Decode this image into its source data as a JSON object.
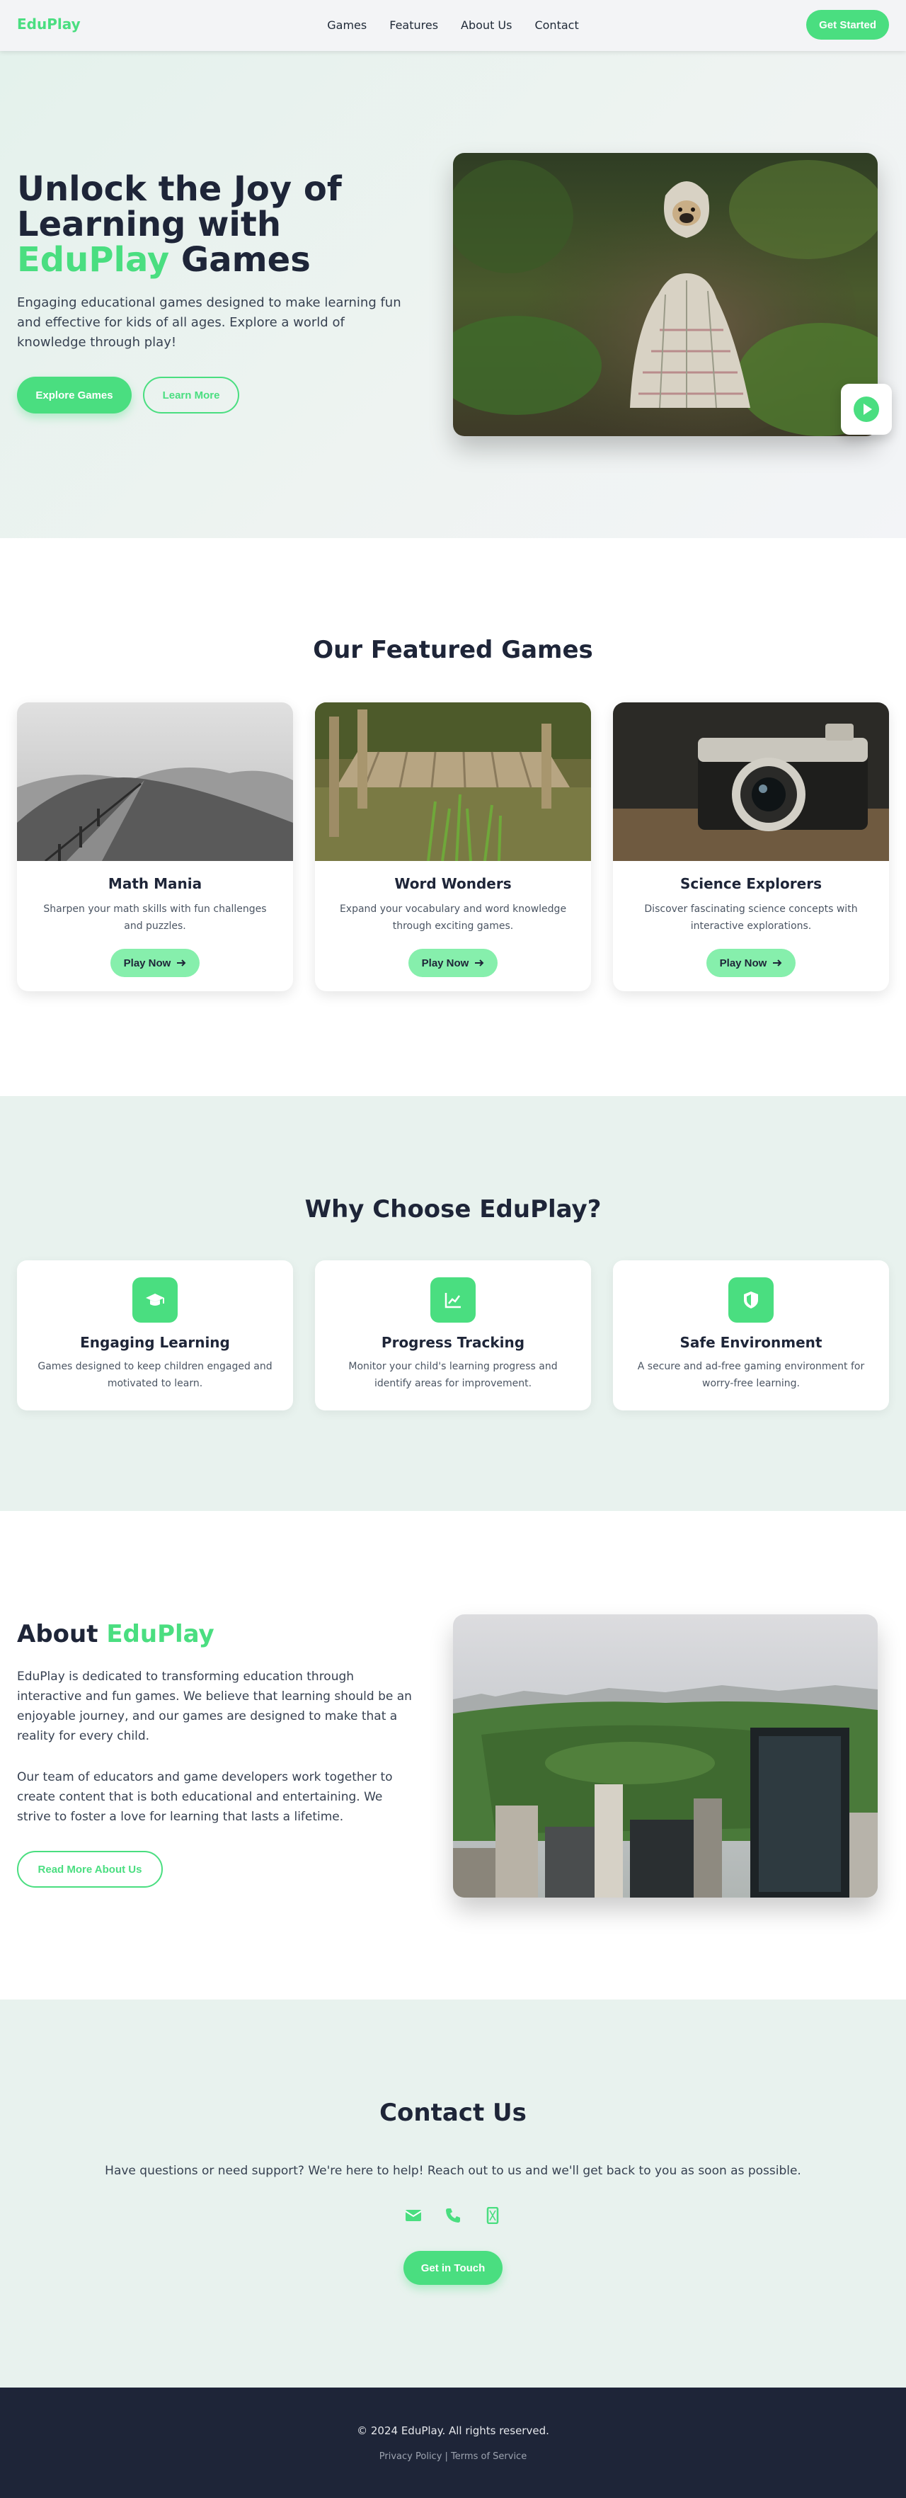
{
  "colors": {
    "accent": "#4ade80",
    "dark": "#1e2538",
    "section_bg": "#e8f2ee"
  },
  "nav": {
    "logo": "EduPlay",
    "links": [
      "Games",
      "Features",
      "About Us",
      "Contact"
    ],
    "cta": "Get Started"
  },
  "hero": {
    "title_part1": "Unlock the Joy of Learning with ",
    "title_accent": "EduPlay",
    "title_part2": " Games",
    "subtitle": "Engaging educational games designed to make learning fun and effective for kids of all ages. Explore a world of knowledge through play!",
    "primary_button": "Explore Games",
    "secondary_button": "Learn More",
    "play_icon": "play-circle-icon"
  },
  "games": {
    "title": "Our Featured Games",
    "items": [
      {
        "name": "Math Mania",
        "description": "Sharpen your math skills with fun challenges and puzzles.",
        "button": "Play Now"
      },
      {
        "name": "Word Wonders",
        "description": "Expand your vocabulary and word knowledge through exciting games.",
        "button": "Play Now"
      },
      {
        "name": "Science Explorers",
        "description": "Discover fascinating science concepts with interactive explorations.",
        "button": "Play Now"
      }
    ]
  },
  "why": {
    "title": "Why Choose EduPlay?",
    "items": [
      {
        "icon": "graduation-cap-icon",
        "title": "Engaging Learning",
        "description": "Games designed to keep children engaged and motivated to learn."
      },
      {
        "icon": "chart-line-icon",
        "title": "Progress Tracking",
        "description": "Monitor your child's learning progress and identify areas for improvement."
      },
      {
        "icon": "shield-icon",
        "title": "Safe Environment",
        "description": "A secure and ad-free gaming environment for worry-free learning."
      }
    ]
  },
  "about": {
    "title_part1": "About ",
    "title_accent": "EduPlay",
    "paragraph1": "EduPlay is dedicated to transforming education through interactive and fun games. We believe that learning should be an enjoyable journey, and our games are designed to make that a reality for every child.",
    "paragraph2": "Our team of educators and game developers work together to create content that is both educational and entertaining. We strive to foster a love for learning that lasts a lifetime.",
    "button": "Read More About Us"
  },
  "contact": {
    "title": "Contact Us",
    "lead": "Have questions or need support? We're here to help! Reach out to us and we'll get back to you as soon as possible.",
    "icons": [
      "envelope-icon",
      "phone-icon",
      "mobile-icon"
    ],
    "button": "Get in Touch"
  },
  "footer": {
    "copyright": "© 2024 EduPlay. All rights reserved.",
    "privacy": "Privacy Policy",
    "separator": "|",
    "terms": "Terms of Service"
  }
}
